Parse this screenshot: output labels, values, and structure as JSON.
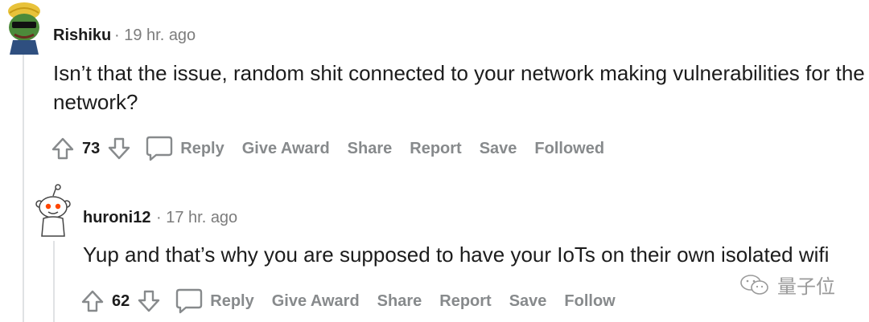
{
  "comments": [
    {
      "username": "Rishiku",
      "time": "· 19 hr. ago",
      "body": "Isn’t that the issue, random shit connected to your network making vulnerabilities for the network?",
      "score": "73",
      "actions": [
        "Reply",
        "Give Award",
        "Share",
        "Report",
        "Save",
        "Followed"
      ]
    },
    {
      "username": "huroni12",
      "time": "· 17 hr. ago",
      "body": "Yup and that’s why you are supposed to have your IoTs on their own isolated wifi",
      "score": "62",
      "actions": [
        "Reply",
        "Give Award",
        "Share",
        "Report",
        "Save",
        "Follow"
      ]
    }
  ],
  "watermark": {
    "text": "量子位"
  },
  "colors": {
    "muted": "#878a8c",
    "line": "#e0e2e4",
    "text": "#1c1c1c"
  },
  "icons": [
    "upvote-icon",
    "downvote-icon",
    "comment-bubble-icon",
    "wechat-icon"
  ]
}
